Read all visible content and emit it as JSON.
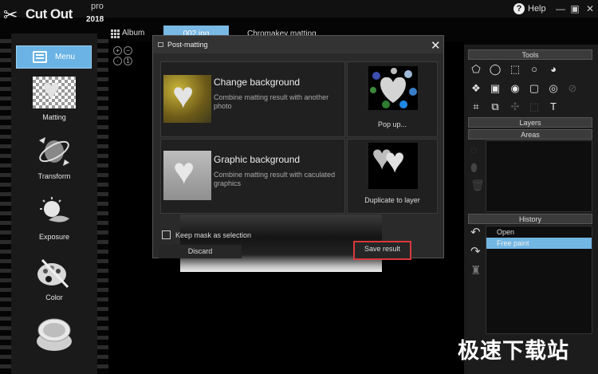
{
  "app": {
    "name": "Cut Out",
    "edition": "pro",
    "year": "2018",
    "help_label": "Help"
  },
  "tabs": [
    {
      "label": "Album"
    },
    {
      "label": "002.jpg"
    },
    {
      "label": "Chromakey matting"
    }
  ],
  "sidebar": {
    "menu_label": "Menu",
    "items": [
      {
        "label": "Matting",
        "icon": "heart-checker-icon"
      },
      {
        "label": "Transform",
        "icon": "transform-icon"
      },
      {
        "label": "Exposure",
        "icon": "exposure-icon"
      },
      {
        "label": "Color",
        "icon": "palette-icon"
      }
    ]
  },
  "dialog": {
    "title": "Post-matting",
    "cards": [
      {
        "title": "Change background",
        "desc": "Combine matting result with another photo"
      },
      {
        "title": "Graphic background",
        "desc": "Combine matting result with caculated graphics"
      }
    ],
    "side_actions": [
      {
        "label": "Pop up..."
      },
      {
        "label": "Duplicate to layer"
      }
    ],
    "keep_mask_label": "Keep mask as selection",
    "discard_label": "Discard",
    "save_label": "Save result"
  },
  "right_panel": {
    "tools_label": "Tools",
    "layers_label": "Layers",
    "areas_label": "Areas",
    "history_label": "History",
    "history": [
      {
        "label": "Open",
        "selected": false
      },
      {
        "label": "Free paint",
        "selected": true
      }
    ]
  },
  "watermark": "极速下载站",
  "colors": {
    "accent": "#6ab3e4",
    "highlight_border": "#d8393d"
  }
}
